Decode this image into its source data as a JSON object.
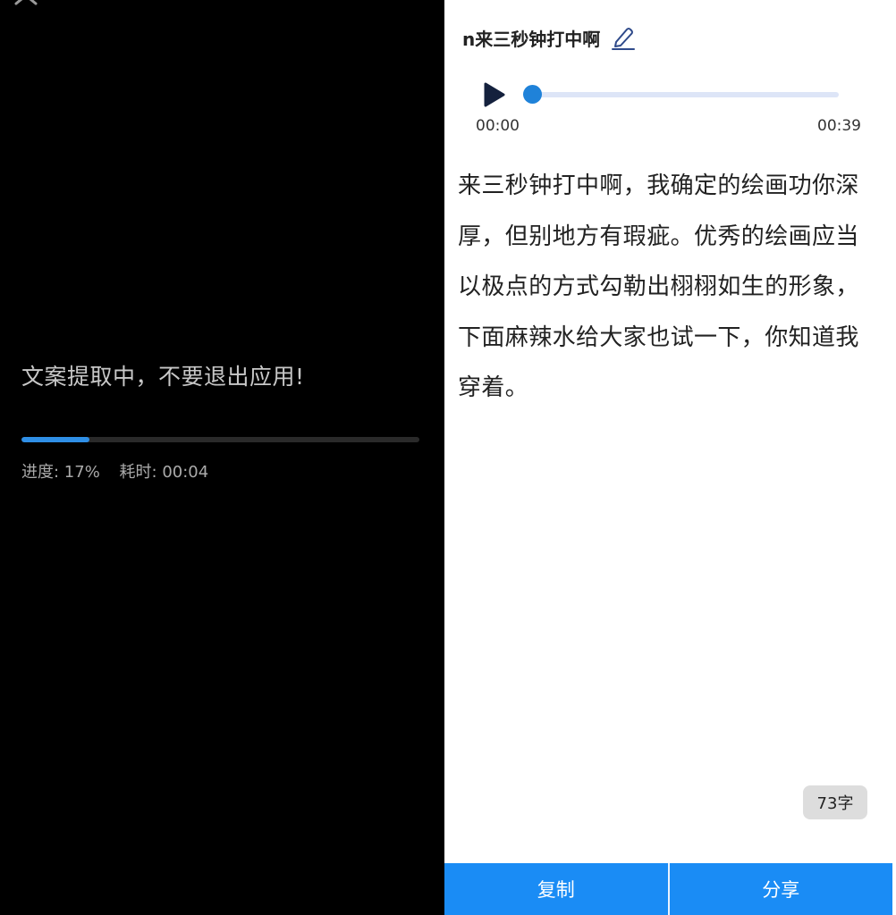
{
  "extraction": {
    "status_message": "文案提取中，不要退出应用!",
    "progress_percent": 17,
    "progress_text": "进度: 17%",
    "elapsed_text": "耗时: 00:04"
  },
  "document": {
    "title": "n来三秒钟打中啊",
    "transcript": "来三秒钟打中啊，我确定的绘画功你深厚，但别地方有瑕疵。优秀的绘画应当以极点的方式勾勒出栩栩如生的形象，下面麻辣水给大家也试一下，你知道我穿着。",
    "char_count": "73字"
  },
  "player": {
    "current_time": "00:00",
    "total_time": "00:39",
    "position_fraction": 0
  },
  "actions": {
    "copy_label": "复制",
    "share_label": "分享"
  },
  "icons": {
    "close": "close-icon",
    "edit": "edit-pencil-icon",
    "play": "play-icon"
  },
  "colors": {
    "accent_blue": "#1a8cf5",
    "progress_blue": "#2f8fe6",
    "seek_thumb": "#1f82d9",
    "seek_track": "#dde5f7",
    "play_icon": "#14213d",
    "left_background": "#000000",
    "right_background": "#ffffff"
  }
}
